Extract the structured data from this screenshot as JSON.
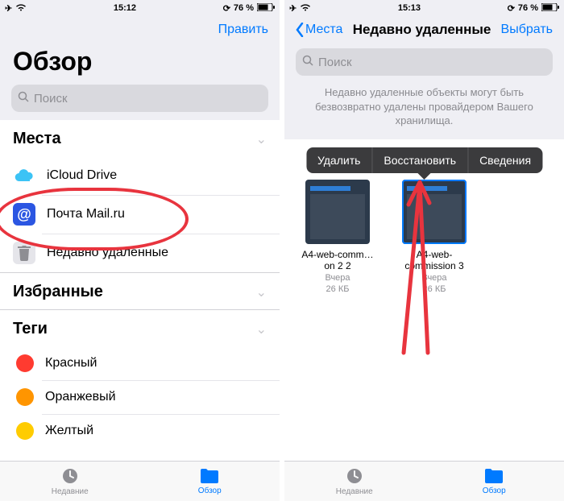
{
  "left": {
    "status": {
      "time": "15:12",
      "battery": "76 %"
    },
    "nav": {
      "edit": "Править"
    },
    "title": "Обзор",
    "search_placeholder": "Поиск",
    "sections": {
      "places": {
        "header": "Места",
        "items": [
          {
            "label": "iCloud Drive"
          },
          {
            "label": "Почта Mail.ru"
          },
          {
            "label": "Недавно удаленные"
          }
        ]
      },
      "favorites": {
        "header": "Избранные"
      },
      "tags": {
        "header": "Теги",
        "items": [
          {
            "label": "Красный",
            "color": "#ff3b30"
          },
          {
            "label": "Оранжевый",
            "color": "#ff9500"
          },
          {
            "label": "Желтый",
            "color": "#ffcc00"
          }
        ]
      }
    },
    "tabs": {
      "recents": "Недавние",
      "browse": "Обзор"
    }
  },
  "right": {
    "status": {
      "time": "15:13",
      "battery": "76 %"
    },
    "nav": {
      "back": "Места",
      "title": "Недавно удаленные",
      "select": "Выбрать"
    },
    "search_placeholder": "Поиск",
    "info": "Недавно удаленные объекты могут быть безвозвратно удалены провайдером Вашего хранилища.",
    "popover": {
      "delete": "Удалить",
      "restore": "Восстановить",
      "details": "Сведения"
    },
    "files": [
      {
        "name": "A4-web-comm…on 2 2",
        "date": "Вчера",
        "size": "26 КБ"
      },
      {
        "name": "A4-web-commission 3",
        "date": "Вчера",
        "size": "26 КБ"
      }
    ],
    "tabs": {
      "recents": "Недавние",
      "browse": "Обзор"
    }
  }
}
